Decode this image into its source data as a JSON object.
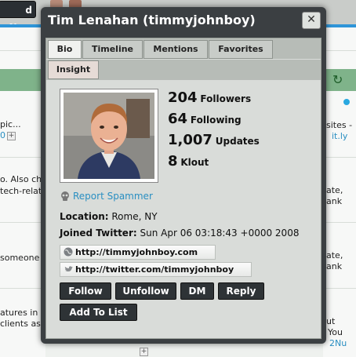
{
  "background": {
    "now_button_label": "d Now",
    "fragments": [
      {
        "text": "pic..."
      },
      {
        "text": "0"
      },
      {
        "text": "sites -"
      },
      {
        "text": "it.ly"
      },
      {
        "text": "o. Also che"
      },
      {
        "text": "tech-relat"
      },
      {
        "text": "ate,"
      },
      {
        "text": "ank"
      },
      {
        "text": "someone"
      },
      {
        "text": "ate,"
      },
      {
        "text": "ank"
      },
      {
        "text": "atures in"
      },
      {
        "text": "clients as"
      },
      {
        "text": "ut"
      },
      {
        "text": "You"
      },
      {
        "text": "2Nu"
      }
    ]
  },
  "dialog": {
    "title": "Tim Lenahan (timmyjohnboy)",
    "close_label": "✕",
    "tabs": [
      {
        "label": "Bio",
        "active": true
      },
      {
        "label": "Timeline"
      },
      {
        "label": "Mentions"
      },
      {
        "label": "Favorites"
      },
      {
        "label": "Insight"
      }
    ],
    "stats": [
      {
        "value": "204",
        "label": "Followers"
      },
      {
        "value": "64",
        "label": "Following"
      },
      {
        "value": "1,007",
        "label": "Updates"
      },
      {
        "value": "8",
        "label": "Klout"
      }
    ],
    "report_spammer": "Report Spammer",
    "location_label": "Location:",
    "location_value": "Rome, NY",
    "joined_label": "Joined Twitter:",
    "joined_value": "Sun Apr 06 03:18:43 +0000 2008",
    "website_url": "http://timmyjohnboy.com",
    "twitter_url": "http://twitter.com/timmyjohnboy",
    "actions": {
      "follow": "Follow",
      "unfollow": "Unfollow",
      "dm": "DM",
      "reply": "Reply",
      "add_to_list": "Add To List"
    },
    "icons": {
      "report": "skull-icon",
      "website": "globe-icon",
      "twitter": "bird-icon"
    }
  }
}
